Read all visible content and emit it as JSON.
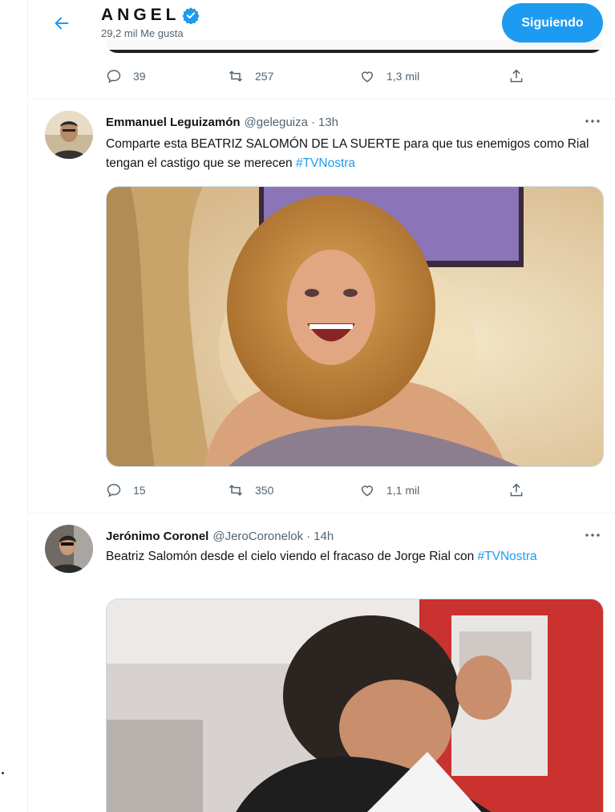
{
  "header": {
    "title": "ANGEL",
    "subtitle": "29,2 mil Me gusta",
    "follow_label": "Siguiendo"
  },
  "previous_tweet": {
    "actions": {
      "replies": "39",
      "retweets": "257",
      "likes": "1,3 mil"
    }
  },
  "tweets": [
    {
      "name": "Emmanuel Leguizamón",
      "handle": "@geleguiza",
      "separator": "·",
      "time": "13h",
      "text_before": "Comparte esta BEATRIZ SALOMÓN DE LA SUERTE para que tus enemigos como Rial tengan el castigo que se merecen ",
      "hashtag": "#TVNostra",
      "text_after": "",
      "actions": {
        "replies": "15",
        "retweets": "350",
        "likes": "1,1 mil"
      }
    },
    {
      "name": "Jerónimo Coronel",
      "handle": "@JeroCoronelok",
      "separator": "·",
      "time": "14h",
      "text_before": "Beatriz Salomón desde el cielo viendo el fracaso de Jorge Rial con ",
      "hashtag": "#TVNostra",
      "text_after": ""
    }
  ],
  "colors": {
    "accent": "#1d9bf0",
    "text": "#0f1419",
    "muted": "#536471",
    "border": "#eff3f4"
  }
}
